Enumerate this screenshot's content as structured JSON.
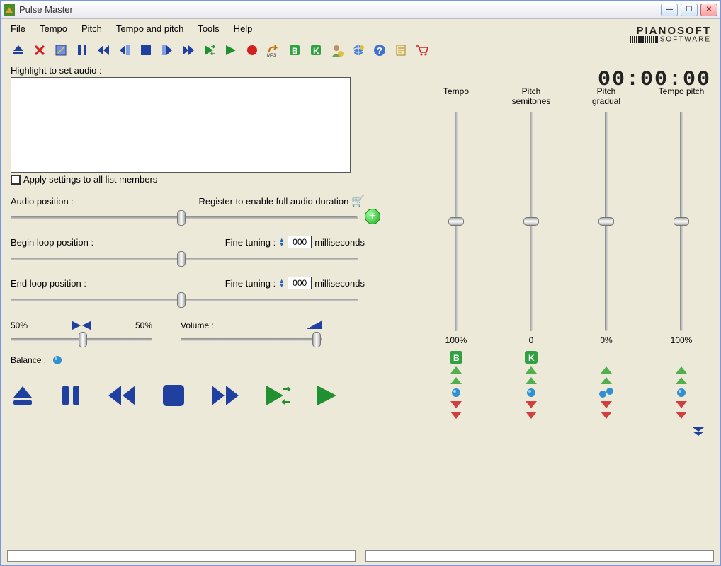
{
  "window": {
    "title": "Pulse Master"
  },
  "brand": {
    "name": "PIANOSOFT",
    "subtitle": "SOFTWARE"
  },
  "menu": {
    "file": "File",
    "tempo": "Tempo",
    "pitch": "Pitch",
    "tempo_pitch": "Tempo and pitch",
    "tools": "Tools",
    "help": "Help"
  },
  "toolbar_icons": [
    "eject",
    "delete",
    "edit",
    "pause",
    "rewind",
    "step-back",
    "stop",
    "step-fwd",
    "fast-fwd",
    "play-loop",
    "play",
    "record",
    "mp3",
    "begin-mark",
    "end-mark",
    "user",
    "globe",
    "help",
    "doc",
    "cart"
  ],
  "time": "00:00:00",
  "left": {
    "highlight_label": "Highlight to set audio :",
    "apply_all": "Apply settings to all list members",
    "audio_pos_label": "Audio position :",
    "register_text": "Register to enable full audio duration",
    "begin_loop_label": "Begin loop position :",
    "end_loop_label": "End loop position :",
    "fine_tuning_label": "Fine tuning :",
    "fine_tuning_value": "000",
    "fine_tuning_unit": "milliseconds",
    "balance_left": "50%",
    "balance_right": "50%",
    "balance_label": "Balance :",
    "volume_label": "Volume :"
  },
  "sliders": {
    "tempo": {
      "label": "Tempo",
      "value": "100%"
    },
    "pitch_semi": {
      "label": "Pitch semitones",
      "value": "0"
    },
    "pitch_grad": {
      "label": "Pitch gradual",
      "value": "0%"
    },
    "tempo_pitch": {
      "label": "Tempo pitch",
      "value": "100%"
    }
  }
}
